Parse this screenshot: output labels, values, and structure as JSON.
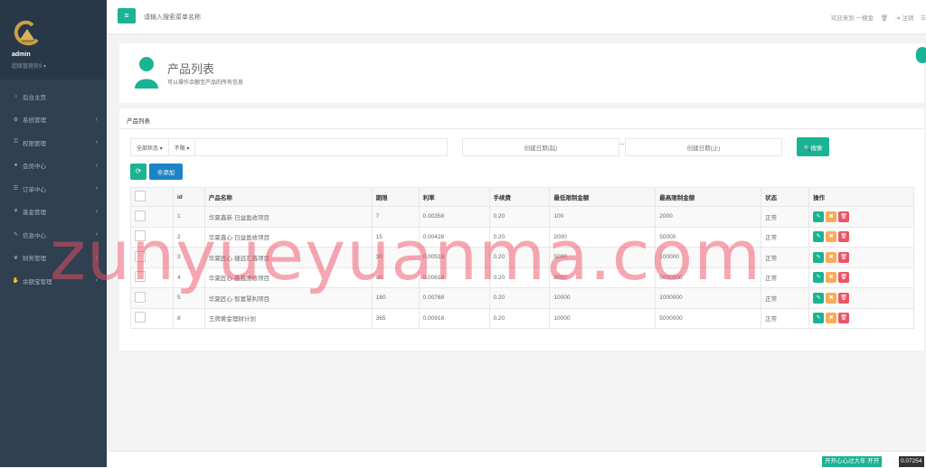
{
  "sidebar": {
    "user_name": "admin",
    "user_role": "超级管理员9 ▾",
    "items": [
      {
        "label": "后台主页",
        "icon": "home-icon",
        "glyph": "⌂",
        "has_children": false
      },
      {
        "label": "系统管理",
        "icon": "cogs-icon",
        "glyph": "⚙",
        "has_children": true
      },
      {
        "label": "权限管理",
        "icon": "key-icon",
        "glyph": "⚿",
        "has_children": true
      },
      {
        "label": "会员中心",
        "icon": "user-icon",
        "glyph": "●",
        "has_children": true
      },
      {
        "label": "订单中心",
        "icon": "list-icon",
        "glyph": "☰",
        "has_children": true
      },
      {
        "label": "基金管理",
        "icon": "yen-icon",
        "glyph": "¥",
        "has_children": true
      },
      {
        "label": "信息中心",
        "icon": "wrench-icon",
        "glyph": "✎",
        "has_children": true
      },
      {
        "label": "财务管理",
        "icon": "leaf-icon",
        "glyph": "❦",
        "has_children": true
      },
      {
        "label": "余额宝管理",
        "icon": "hand-icon",
        "glyph": "✋",
        "has_children": true
      }
    ],
    "chevron": "‹"
  },
  "topbar": {
    "menu_icon": "≡",
    "search_placeholder": "请输入搜索菜单名称",
    "welcome": "欢迎来到 一横金",
    "trash_icon": "🗑",
    "logout_icon": "⇥",
    "logout": "注销",
    "more_icon": "☰"
  },
  "header": {
    "title": "产品列表",
    "subtitle": "可以操作余额宝产品的所有信息"
  },
  "panel": {
    "title": "产品列表",
    "filter_status": "全部状态 ▾",
    "filter_period": "不限 ▾",
    "date_start": "创建日期(起)",
    "date_tilde": "~",
    "date_end": "创建日期(止)",
    "search_button": "🔍搜索",
    "refresh_icon": "⟳",
    "add_button": "⊕添加"
  },
  "table": {
    "headers": [
      "",
      "id",
      "产品名称",
      "期限",
      "利率",
      "手续费",
      "最低限制金额",
      "最高限制金额",
      "状态",
      "操作"
    ],
    "rows": [
      [
        "1",
        "华夏鑫新·日益盈收项目",
        "7",
        "0.00358",
        "0.20",
        "100",
        "2000",
        "正常"
      ],
      [
        "2",
        "华夏鑫心·日益盈收项目",
        "15",
        "0.00428",
        "0.20",
        "2000",
        "50000",
        "正常"
      ],
      [
        "3",
        "华夏匠心·捷远汇鑫项目",
        "30",
        "0.00518",
        "0.20",
        "5000",
        "100000",
        "正常"
      ],
      [
        "4",
        "华夏匠心·鑫鑫图收项目",
        "90",
        "0.00618",
        "0.20",
        "8000",
        "5000000",
        "正常"
      ],
      [
        "5",
        "华夏匠心·智富慧利项目",
        "180",
        "0.00768",
        "0.20",
        "10000",
        "1000000",
        "正常"
      ],
      [
        "8",
        "王牌黄金理财计划",
        "365",
        "0.00918",
        "0.20",
        "10000",
        "5000000",
        "正常"
      ]
    ],
    "op_icons": {
      "edit": "✎",
      "warn": "✖",
      "delete": "🗑"
    }
  },
  "footer": {
    "ticker": "开开心心过大年 开开",
    "ticker_value": "0.07254"
  },
  "watermark": "zunyueyuanma.com",
  "colors": {
    "sidebar": "#2f4050",
    "primary": "#1ab394",
    "info": "#1c84c6",
    "warning": "#f8ac59",
    "danger": "#ed5565"
  }
}
